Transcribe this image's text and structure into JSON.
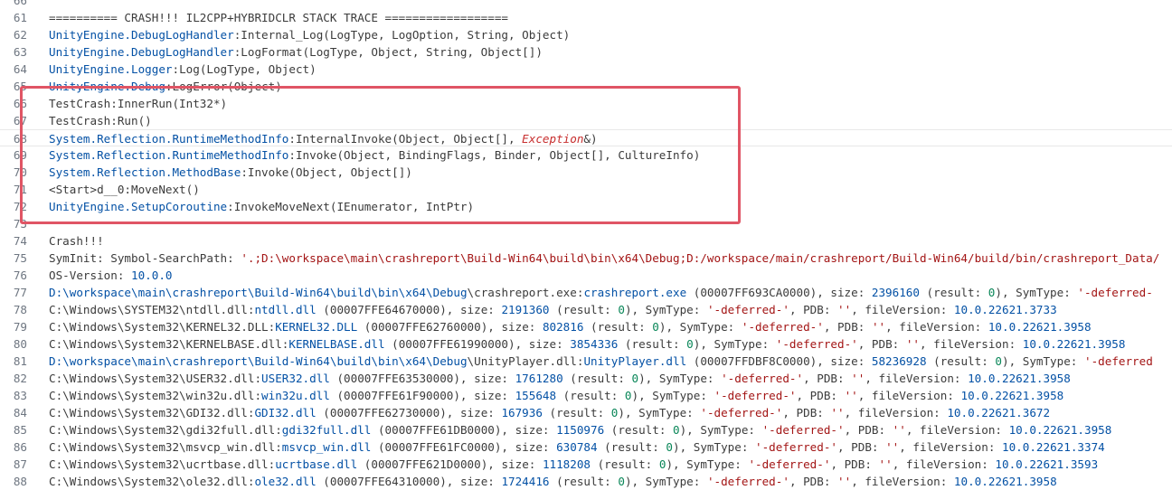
{
  "editor": {
    "lines": [
      {
        "n": "66",
        "tokens": []
      },
      {
        "n": "61",
        "tokens": [
          {
            "t": "========== CRASH!!! IL2CPP+HYBRIDCLR STACK TRACE ==================",
            "c": "text"
          }
        ]
      },
      {
        "n": "62",
        "tokens": [
          {
            "t": "UnityEngine.DebugLogHandler",
            "c": "type"
          },
          {
            "t": ":Internal_Log(LogType, LogOption, String, Object)",
            "c": "text"
          }
        ]
      },
      {
        "n": "63",
        "tokens": [
          {
            "t": "UnityEngine.DebugLogHandler",
            "c": "type"
          },
          {
            "t": ":LogFormat(LogType, Object, String, Object[])",
            "c": "text"
          }
        ]
      },
      {
        "n": "64",
        "tokens": [
          {
            "t": "UnityEngine.Logger",
            "c": "type"
          },
          {
            "t": ":Log(LogType, Object)",
            "c": "text"
          }
        ]
      },
      {
        "n": "65",
        "tokens": [
          {
            "t": "UnityEngine.Debug",
            "c": "type"
          },
          {
            "t": ":LogError(Object)",
            "c": "text"
          }
        ]
      },
      {
        "n": "66",
        "tokens": [
          {
            "t": "TestCrash:InnerRun(Int32*)",
            "c": "text"
          }
        ]
      },
      {
        "n": "67",
        "tokens": [
          {
            "t": "TestCrash:Run()",
            "c": "text"
          }
        ]
      },
      {
        "n": "68",
        "cursor": true,
        "tokens": [
          {
            "t": "System.Reflection.RuntimeMethodInfo",
            "c": "type"
          },
          {
            "t": ":InternalInvoke(Object, Object[], ",
            "c": "text"
          },
          {
            "t": "Exception",
            "c": "exc"
          },
          {
            "t": "&)",
            "c": "text"
          }
        ]
      },
      {
        "n": "69",
        "tokens": [
          {
            "t": "System.Reflection.RuntimeMethodInfo",
            "c": "type"
          },
          {
            "t": ":Invoke(Object, BindingFlags, Binder, Object[], CultureInfo)",
            "c": "text"
          }
        ]
      },
      {
        "n": "70",
        "tokens": [
          {
            "t": "System.Reflection.MethodBase",
            "c": "type"
          },
          {
            "t": ":Invoke(Object, Object[])",
            "c": "text"
          }
        ]
      },
      {
        "n": "71",
        "tokens": [
          {
            "t": "<Start>d__0:MoveNext()",
            "c": "text"
          }
        ]
      },
      {
        "n": "72",
        "tokens": [
          {
            "t": "UnityEngine.SetupCoroutine",
            "c": "type"
          },
          {
            "t": ":InvokeMoveNext(IEnumerator, IntPtr)",
            "c": "text"
          }
        ]
      },
      {
        "n": "73",
        "tokens": []
      },
      {
        "n": "74",
        "tokens": [
          {
            "t": "Crash!!!",
            "c": "text"
          }
        ]
      },
      {
        "n": "75",
        "tokens": [
          {
            "t": "SymInit: Symbol-SearchPath: ",
            "c": "text"
          },
          {
            "t": "'.;D:\\workspace\\main\\crashreport\\Build-Win64\\build\\bin\\x64\\Debug;D:/workspace/main/crashreport/Build-Win64/build/bin/crashreport_Data/",
            "c": "str"
          }
        ]
      },
      {
        "n": "76",
        "tokens": [
          {
            "t": "OS-Version: ",
            "c": "text"
          },
          {
            "t": "10.0.0",
            "c": "type"
          }
        ]
      },
      {
        "n": "77",
        "tokens": [
          {
            "t": "D:\\workspace\\main\\crashreport\\Build-Win64\\build\\bin\\x64\\",
            "c": "type"
          },
          {
            "t": "Debug",
            "c": "type"
          },
          {
            "t": "\\crashreport.exe:",
            "c": "text"
          },
          {
            "t": "crashreport.exe",
            "c": "type"
          },
          {
            "t": " (00007FF693CA0000), size: ",
            "c": "text"
          },
          {
            "t": "2396160",
            "c": "type"
          },
          {
            "t": " (result: ",
            "c": "text"
          },
          {
            "t": "0",
            "c": "num"
          },
          {
            "t": "), SymType: ",
            "c": "text"
          },
          {
            "t": "'-deferred-",
            "c": "str"
          }
        ]
      },
      {
        "n": "78",
        "tokens": [
          {
            "t": "C:\\Windows\\SYSTEM32\\ntdll.dll:",
            "c": "text"
          },
          {
            "t": "ntdll.dll",
            "c": "type"
          },
          {
            "t": " (00007FFE64670000), size: ",
            "c": "text"
          },
          {
            "t": "2191360",
            "c": "type"
          },
          {
            "t": " (result: ",
            "c": "text"
          },
          {
            "t": "0",
            "c": "num"
          },
          {
            "t": "), SymType: ",
            "c": "text"
          },
          {
            "t": "'-deferred-'",
            "c": "str"
          },
          {
            "t": ", PDB: ",
            "c": "text"
          },
          {
            "t": "''",
            "c": "str"
          },
          {
            "t": ", fileVersion: ",
            "c": "text"
          },
          {
            "t": "10.0.22621.3733",
            "c": "type"
          }
        ]
      },
      {
        "n": "79",
        "tokens": [
          {
            "t": "C:\\Windows\\System32\\KERNEL32.DLL:",
            "c": "text"
          },
          {
            "t": "KERNEL32.DLL",
            "c": "type"
          },
          {
            "t": " (00007FFE62760000), size: ",
            "c": "text"
          },
          {
            "t": "802816",
            "c": "type"
          },
          {
            "t": " (result: ",
            "c": "text"
          },
          {
            "t": "0",
            "c": "num"
          },
          {
            "t": "), SymType: ",
            "c": "text"
          },
          {
            "t": "'-deferred-'",
            "c": "str"
          },
          {
            "t": ", PDB: ",
            "c": "text"
          },
          {
            "t": "''",
            "c": "str"
          },
          {
            "t": ", fileVersion: ",
            "c": "text"
          },
          {
            "t": "10.0.22621.3958",
            "c": "type"
          }
        ]
      },
      {
        "n": "80",
        "tokens": [
          {
            "t": "C:\\Windows\\System32\\KERNELBASE.dll:",
            "c": "text"
          },
          {
            "t": "KERNELBASE.dll",
            "c": "type"
          },
          {
            "t": " (00007FFE61990000), size: ",
            "c": "text"
          },
          {
            "t": "3854336",
            "c": "type"
          },
          {
            "t": " (result: ",
            "c": "text"
          },
          {
            "t": "0",
            "c": "num"
          },
          {
            "t": "), SymType: ",
            "c": "text"
          },
          {
            "t": "'-deferred-'",
            "c": "str"
          },
          {
            "t": ", PDB: ",
            "c": "text"
          },
          {
            "t": "''",
            "c": "str"
          },
          {
            "t": ", fileVersion: ",
            "c": "text"
          },
          {
            "t": "10.0.22621.3958",
            "c": "type"
          }
        ]
      },
      {
        "n": "81",
        "tokens": [
          {
            "t": "D:\\workspace\\main\\crashreport\\Build-Win64\\build\\bin\\x64\\",
            "c": "type"
          },
          {
            "t": "Debug",
            "c": "type"
          },
          {
            "t": "\\UnityPlayer.dll:",
            "c": "text"
          },
          {
            "t": "UnityPlayer.dll",
            "c": "type"
          },
          {
            "t": " (00007FFDBF8C0000), size: ",
            "c": "text"
          },
          {
            "t": "58236928",
            "c": "type"
          },
          {
            "t": " (result: ",
            "c": "text"
          },
          {
            "t": "0",
            "c": "num"
          },
          {
            "t": "), SymType: ",
            "c": "text"
          },
          {
            "t": "'-deferred",
            "c": "str"
          }
        ]
      },
      {
        "n": "82",
        "tokens": [
          {
            "t": "C:\\Windows\\System32\\USER32.dll:",
            "c": "text"
          },
          {
            "t": "USER32.dll",
            "c": "type"
          },
          {
            "t": " (00007FFE63530000), size: ",
            "c": "text"
          },
          {
            "t": "1761280",
            "c": "type"
          },
          {
            "t": " (result: ",
            "c": "text"
          },
          {
            "t": "0",
            "c": "num"
          },
          {
            "t": "), SymType: ",
            "c": "text"
          },
          {
            "t": "'-deferred-'",
            "c": "str"
          },
          {
            "t": ", PDB: ",
            "c": "text"
          },
          {
            "t": "''",
            "c": "str"
          },
          {
            "t": ", fileVersion: ",
            "c": "text"
          },
          {
            "t": "10.0.22621.3958",
            "c": "type"
          }
        ]
      },
      {
        "n": "83",
        "tokens": [
          {
            "t": "C:\\Windows\\System32\\win32u.dll:",
            "c": "text"
          },
          {
            "t": "win32u.dll",
            "c": "type"
          },
          {
            "t": " (00007FFE61F90000), size: ",
            "c": "text"
          },
          {
            "t": "155648",
            "c": "type"
          },
          {
            "t": " (result: ",
            "c": "text"
          },
          {
            "t": "0",
            "c": "num"
          },
          {
            "t": "), SymType: ",
            "c": "text"
          },
          {
            "t": "'-deferred-'",
            "c": "str"
          },
          {
            "t": ", PDB: ",
            "c": "text"
          },
          {
            "t": "''",
            "c": "str"
          },
          {
            "t": ", fileVersion: ",
            "c": "text"
          },
          {
            "t": "10.0.22621.3958",
            "c": "type"
          }
        ]
      },
      {
        "n": "84",
        "tokens": [
          {
            "t": "C:\\Windows\\System32\\GDI32.dll:",
            "c": "text"
          },
          {
            "t": "GDI32.dll",
            "c": "type"
          },
          {
            "t": " (00007FFE62730000), size: ",
            "c": "text"
          },
          {
            "t": "167936",
            "c": "type"
          },
          {
            "t": " (result: ",
            "c": "text"
          },
          {
            "t": "0",
            "c": "num"
          },
          {
            "t": "), SymType: ",
            "c": "text"
          },
          {
            "t": "'-deferred-'",
            "c": "str"
          },
          {
            "t": ", PDB: ",
            "c": "text"
          },
          {
            "t": "''",
            "c": "str"
          },
          {
            "t": ", fileVersion: ",
            "c": "text"
          },
          {
            "t": "10.0.22621.3672",
            "c": "type"
          }
        ]
      },
      {
        "n": "85",
        "tokens": [
          {
            "t": "C:\\Windows\\System32\\gdi32full.dll:",
            "c": "text"
          },
          {
            "t": "gdi32full.dll",
            "c": "type"
          },
          {
            "t": " (00007FFE61DB0000), size: ",
            "c": "text"
          },
          {
            "t": "1150976",
            "c": "type"
          },
          {
            "t": " (result: ",
            "c": "text"
          },
          {
            "t": "0",
            "c": "num"
          },
          {
            "t": "), SymType: ",
            "c": "text"
          },
          {
            "t": "'-deferred-'",
            "c": "str"
          },
          {
            "t": ", PDB: ",
            "c": "text"
          },
          {
            "t": "''",
            "c": "str"
          },
          {
            "t": ", fileVersion: ",
            "c": "text"
          },
          {
            "t": "10.0.22621.3958",
            "c": "type"
          }
        ]
      },
      {
        "n": "86",
        "tokens": [
          {
            "t": "C:\\Windows\\System32\\msvcp_win.dll:",
            "c": "text"
          },
          {
            "t": "msvcp_win.dll",
            "c": "type"
          },
          {
            "t": " (00007FFE61FC0000), size: ",
            "c": "text"
          },
          {
            "t": "630784",
            "c": "type"
          },
          {
            "t": " (result: ",
            "c": "text"
          },
          {
            "t": "0",
            "c": "num"
          },
          {
            "t": "), SymType: ",
            "c": "text"
          },
          {
            "t": "'-deferred-'",
            "c": "str"
          },
          {
            "t": ", PDB: ",
            "c": "text"
          },
          {
            "t": "''",
            "c": "str"
          },
          {
            "t": ", fileVersion: ",
            "c": "text"
          },
          {
            "t": "10.0.22621.3374",
            "c": "type"
          }
        ]
      },
      {
        "n": "87",
        "tokens": [
          {
            "t": "C:\\Windows\\System32\\ucrtbase.dll:",
            "c": "text"
          },
          {
            "t": "ucrtbase.dll",
            "c": "type"
          },
          {
            "t": " (00007FFE621D0000), size: ",
            "c": "text"
          },
          {
            "t": "1118208",
            "c": "type"
          },
          {
            "t": " (result: ",
            "c": "text"
          },
          {
            "t": "0",
            "c": "num"
          },
          {
            "t": "), SymType: ",
            "c": "text"
          },
          {
            "t": "'-deferred-'",
            "c": "str"
          },
          {
            "t": ", PDB: ",
            "c": "text"
          },
          {
            "t": "''",
            "c": "str"
          },
          {
            "t": ", fileVersion: ",
            "c": "text"
          },
          {
            "t": "10.0.22621.3593",
            "c": "type"
          }
        ]
      },
      {
        "n": "88",
        "tokens": [
          {
            "t": "C:\\Windows\\System32\\ole32.dll:",
            "c": "text"
          },
          {
            "t": "ole32.dll",
            "c": "type"
          },
          {
            "t": " (00007FFE64310000), size: ",
            "c": "text"
          },
          {
            "t": "1724416",
            "c": "type"
          },
          {
            "t": " (result: ",
            "c": "text"
          },
          {
            "t": "0",
            "c": "num"
          },
          {
            "t": "), SymType: ",
            "c": "text"
          },
          {
            "t": "'-deferred-'",
            "c": "str"
          },
          {
            "t": ", PDB: ",
            "c": "text"
          },
          {
            "t": "''",
            "c": "str"
          },
          {
            "t": ", fileVersion: ",
            "c": "text"
          },
          {
            "t": "10.0.22621.3958",
            "c": "type"
          }
        ]
      }
    ]
  },
  "colors": {
    "text": "#3b3b3b",
    "type": "#0451a5",
    "string": "#a31515",
    "number": "#098658",
    "exception": "#c72e2e",
    "line_number": "#6e7681",
    "highlight_border": "#e05565"
  }
}
